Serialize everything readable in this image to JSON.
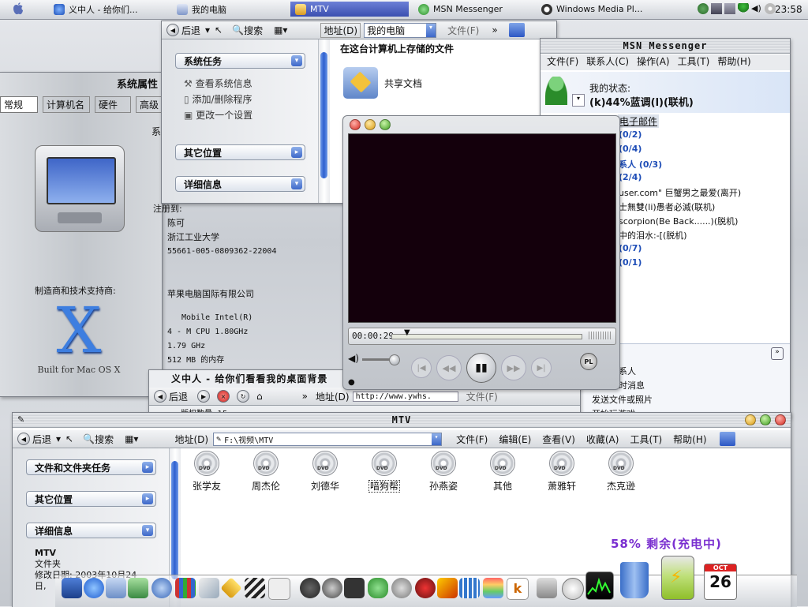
{
  "taskbar": {
    "tasks": [
      {
        "label": "义中人 - 给你们..."
      },
      {
        "label": "我的电脑"
      },
      {
        "label": "MTV"
      },
      {
        "label": "MSN Messenger"
      },
      {
        "label": "Windows Media Pl..."
      }
    ],
    "clock": "23:58"
  },
  "sysprops": {
    "title": "系统属性",
    "tabs": [
      "常规",
      "计算机名",
      "硬件",
      "高级"
    ],
    "partial_label": "系",
    "registered_label": "注册到:",
    "reg_name": "陈可",
    "reg_org": "浙江工业大学",
    "reg_id": "55661-005-0809362-22004",
    "manufacturer_label": "制造商和技术支持商:",
    "manufacturer": "苹果电脑国际有限公司",
    "cpu_model": "Mobile Intel(R)",
    "cpu": "4 - M CPU 1.80GHz",
    "speed": "1.79 GHz",
    "ram": "512 MB 的内存",
    "logo_letter": "X",
    "logo_text": "Built for Mac OS X"
  },
  "mycomputer": {
    "back": "后退",
    "search": "搜索",
    "address_label": "地址(D)",
    "address": "我的电脑",
    "file_menu": "文件(F)",
    "system_tasks": "系统任务",
    "task_items": [
      "查看系统信息",
      "添加/删除程序",
      "更改一个设置"
    ],
    "other_places": "其它位置",
    "details": "详细信息",
    "content_header": "在这台计算机上存储的文件",
    "shared_docs": "共享文档"
  },
  "msn": {
    "title": "MSN Messenger",
    "menu": [
      "文件(F)",
      "联系人(C)",
      "操作(A)",
      "工具(T)",
      "帮助(H)"
    ],
    "status_label": "我的状态:",
    "status": "(k)44%蓝调(l)(联机)",
    "email_link": "电子邮件",
    "contacts": [
      "(0/2)",
      "(0/4)",
      "系人 (0/3)",
      "(2/4)",
      "user.com\" 巨蟹男之最爱(离开)",
      "士無雙(li)愚者必滅(联机)",
      "scorpion(Be Back......)(脱机)",
      "中的泪水:-[(脱机)",
      "(0/7)",
      "(0/1)"
    ],
    "bottom_items": [
      "系人",
      "时消息",
      "发送文件或照片",
      "开始玩游戏"
    ]
  },
  "player": {
    "time": "00:00:29",
    "pl_label": "PL"
  },
  "ie": {
    "title": "义中人 - 给你们看看我的桌面背景",
    "back": "后退",
    "address_label": "地址(D)",
    "address": "http://www.ywhs.",
    "file_menu": "文件(F)",
    "partial_text": "版权数量: 15"
  },
  "mtv": {
    "title": "MTV",
    "back": "后退",
    "search": "搜索",
    "address_label": "地址(D)",
    "address": "F:\\视频\\MTV",
    "menu": [
      "文件(F)",
      "编辑(E)",
      "查看(V)",
      "收藏(A)",
      "工具(T)",
      "帮助(H)"
    ],
    "task_panel": "文件和文件夹任务",
    "other_places": "其它位置",
    "details": "详细信息",
    "detail_name": "MTV",
    "detail_type": "文件夹",
    "detail_date": "修改日期: 2003年10月24",
    "detail_more": "日,",
    "dvd_label": "DVD",
    "folders": [
      "张学友",
      "周杰伦",
      "刘德华",
      "喑狗帮",
      "孙燕姿",
      "其他",
      "萧雅轩",
      "杰克逊"
    ]
  },
  "battery": {
    "text": "58% 剩余(充电中)"
  },
  "dock": {
    "calendar_month": "OCT",
    "calendar_day": "26"
  }
}
